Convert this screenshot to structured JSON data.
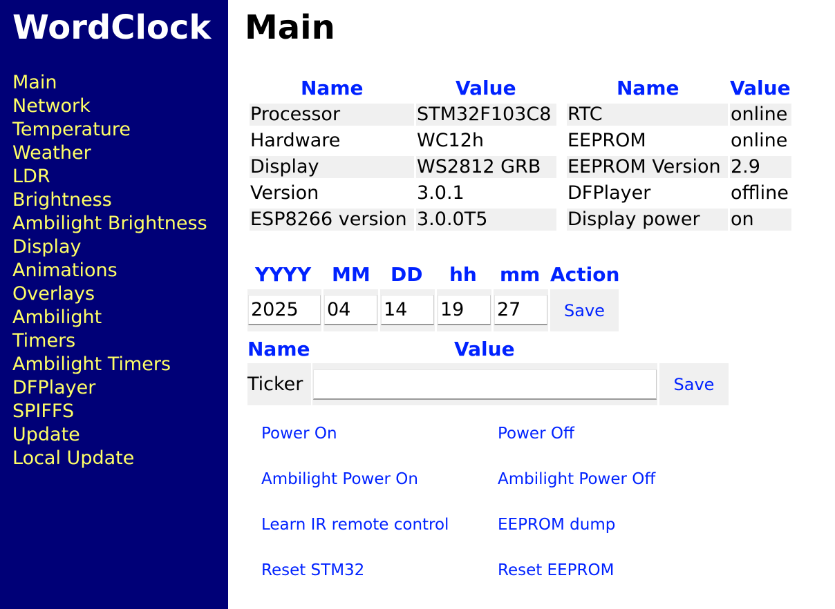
{
  "app": {
    "title": "WordClock"
  },
  "nav": {
    "items": [
      {
        "label": "Main"
      },
      {
        "label": "Network"
      },
      {
        "label": "Temperature"
      },
      {
        "label": "Weather"
      },
      {
        "label": "LDR"
      },
      {
        "label": "Brightness"
      },
      {
        "label": "Ambilight Brightness"
      },
      {
        "label": "Display"
      },
      {
        "label": "Animations"
      },
      {
        "label": "Overlays"
      },
      {
        "label": "Ambilight"
      },
      {
        "label": "Timers"
      },
      {
        "label": "Ambilight Timers"
      },
      {
        "label": "DFPlayer"
      },
      {
        "label": "SPIFFS"
      },
      {
        "label": "Update"
      },
      {
        "label": "Local Update"
      }
    ]
  },
  "page": {
    "title": "Main"
  },
  "status_table": {
    "headers": [
      "Name",
      "Value",
      "Name",
      "Value"
    ],
    "rows": [
      [
        "Processor",
        "STM32F103C8",
        "RTC",
        "online"
      ],
      [
        "Hardware",
        "WC12h",
        "EEPROM",
        "online"
      ],
      [
        "Display",
        "WS2812 GRB",
        "EEPROM Version",
        "2.9"
      ],
      [
        "Version",
        "3.0.1",
        "DFPlayer",
        "offline"
      ],
      [
        "ESP8266 version",
        "3.0.0T5",
        "Display power",
        "on"
      ]
    ]
  },
  "time_form": {
    "headers": [
      "YYYY",
      "MM",
      "DD",
      "hh",
      "mm",
      "Action"
    ],
    "values": [
      "2025",
      "04",
      "14",
      "19",
      "27"
    ],
    "save_label": "Save"
  },
  "ticker_form": {
    "headers": [
      "Name",
      "Value"
    ],
    "label": "Ticker",
    "value": "",
    "save_label": "Save"
  },
  "actions": [
    [
      "Power On",
      "Power Off"
    ],
    [
      "Ambilight Power On",
      "Ambilight Power Off"
    ],
    [
      "Learn IR remote control",
      "EEPROM dump"
    ],
    [
      "Reset STM32",
      "Reset EEPROM"
    ]
  ],
  "colors": {
    "sidebar_bg": "#000077",
    "nav_text": "#ffff66",
    "accent_blue": "#0022ff",
    "row_alt_bg": "#f0f0f0"
  }
}
